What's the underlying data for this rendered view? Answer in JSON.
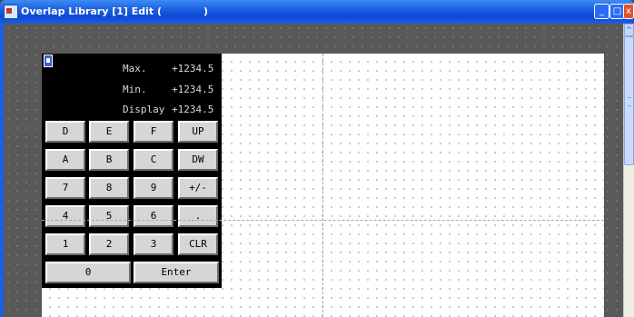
{
  "window": {
    "title": "Overlap Library [1] Edit (            )",
    "minimize_glyph": "_",
    "maximize_glyph": "□",
    "close_glyph": "x"
  },
  "scrollbar": {
    "up_glyph": "^"
  },
  "keypad": {
    "readouts": [
      {
        "label": "Max.",
        "value": "+1234.5"
      },
      {
        "label": "Min.",
        "value": "+1234.5"
      },
      {
        "label": "Display",
        "value": "+1234.5"
      }
    ],
    "keys": [
      [
        "D",
        "E",
        "F",
        "UP"
      ],
      [
        "A",
        "B",
        "C",
        "DW"
      ],
      [
        "7",
        "8",
        "9",
        "+/-"
      ],
      [
        "4",
        "5",
        "6",
        "."
      ],
      [
        "1",
        "2",
        "3",
        "CLR"
      ]
    ],
    "bottom_keys": [
      "0",
      "Enter"
    ]
  },
  "icons": {
    "app": "overlap-library-app-icon",
    "keypad": "keypad-object-icon"
  }
}
